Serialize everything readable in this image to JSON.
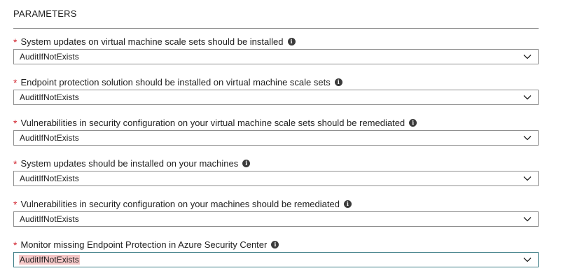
{
  "section": {
    "title": "PARAMETERS"
  },
  "parameters": [
    {
      "label": "System updates on virtual machine scale sets should be installed",
      "required_mark": "*",
      "info_icon": "i",
      "value": "AuditIfNotExists"
    },
    {
      "label": "Endpoint protection solution should be installed on virtual machine scale sets",
      "required_mark": "*",
      "info_icon": "i",
      "value": "AuditIfNotExists"
    },
    {
      "label": "Vulnerabilities in security configuration on your virtual machine scale sets should be remediated",
      "required_mark": "*",
      "info_icon": "i",
      "value": "AuditIfNotExists"
    },
    {
      "label": "System updates should be installed on your machines",
      "required_mark": "*",
      "info_icon": "i",
      "value": "AuditIfNotExists"
    },
    {
      "label": "Vulnerabilities in security configuration on your machines should be remediated",
      "required_mark": "*",
      "info_icon": "i",
      "value": "AuditIfNotExists"
    },
    {
      "label": "Monitor missing Endpoint Protection in Azure Security Center",
      "required_mark": "*",
      "info_icon": "i",
      "value": "AuditIfNotExists"
    }
  ],
  "icons": {
    "info": "info-icon",
    "dropdown": "chevron-down-icon"
  },
  "colors": {
    "required_star": "#d1242f",
    "focused_border": "#3d7d86",
    "text_highlight": "#f4c7c7"
  }
}
